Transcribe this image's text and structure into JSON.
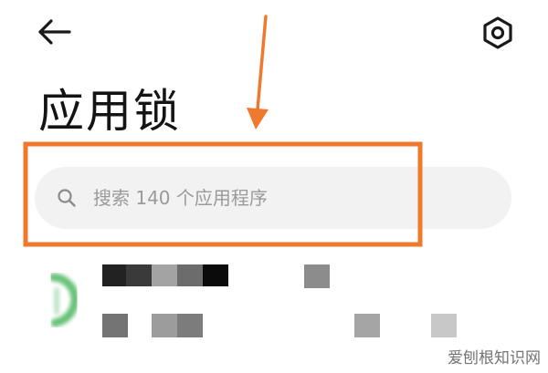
{
  "header": {
    "back_icon": "arrow-left-icon",
    "settings_icon": "gear-icon"
  },
  "page": {
    "title": "应用锁"
  },
  "search": {
    "placeholder": "搜索 140 个应用程序",
    "icon": "search-icon"
  },
  "colors": {
    "annotation_orange": "#ef7a2e",
    "search_background": "#f2f2f2",
    "placeholder_text": "#9a9a9a",
    "title_text": "#141414"
  },
  "watermark": {
    "text": "爱刨根知识网"
  }
}
